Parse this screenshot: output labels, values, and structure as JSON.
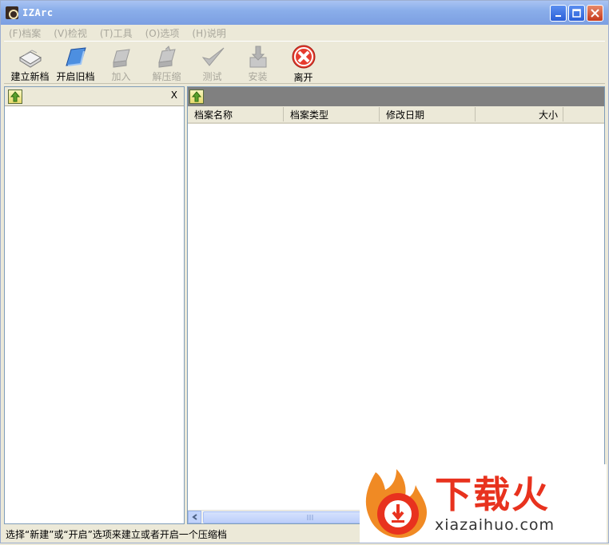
{
  "window": {
    "title": "IZArc"
  },
  "menu": [
    {
      "key": "(F)",
      "label": "档案"
    },
    {
      "key": "(V)",
      "label": "检视"
    },
    {
      "key": "(T)",
      "label": "工具"
    },
    {
      "key": "(O)",
      "label": "选项"
    },
    {
      "key": "(H)",
      "label": "说明"
    }
  ],
  "toolbar": [
    {
      "label": "建立新档",
      "icon": "new-archive-icon",
      "enabled": true
    },
    {
      "label": "开启旧档",
      "icon": "open-archive-icon",
      "enabled": true
    },
    {
      "label": "加入",
      "icon": "add-icon",
      "enabled": false
    },
    {
      "label": "解压缩",
      "icon": "extract-icon",
      "enabled": false
    },
    {
      "label": "测试",
      "icon": "test-icon",
      "enabled": false
    },
    {
      "label": "安装",
      "icon": "install-icon",
      "enabled": false
    },
    {
      "label": "离开",
      "icon": "exit-icon",
      "enabled": true
    }
  ],
  "left_pane": {
    "close_label": "X"
  },
  "file_list": {
    "columns": [
      "档案名称",
      "档案类型",
      "修改日期",
      "大小"
    ],
    "rows": []
  },
  "status": {
    "text": "选择“新建”或“开启”选项来建立或者开启一个压缩档"
  },
  "watermark": {
    "cn": "下载火",
    "en": "xiazaihuo.com"
  },
  "colors": {
    "accent_red": "#e8321e",
    "titlebar_blue": "#8aaeea",
    "path_bar_gray": "#808080"
  }
}
